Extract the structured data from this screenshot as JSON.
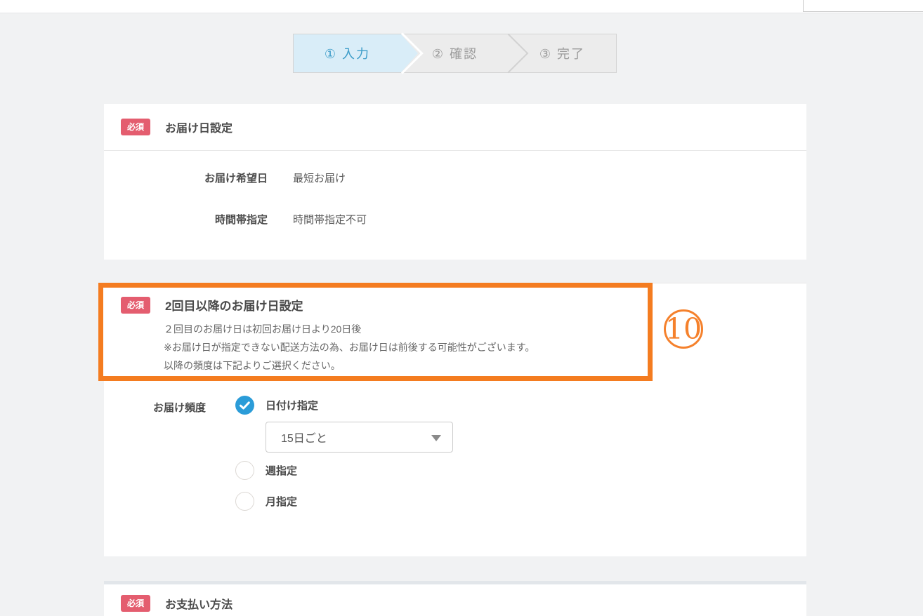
{
  "theme": {
    "background": "#f1f2f3",
    "card_bg": "#ffffff",
    "accent_orange": "#f47c20",
    "badge_red": "#e45d6f",
    "radio_selected_blue": "#2b9cd8",
    "stepper_active_bg": "#d9edf8",
    "stepper_active_text": "#3e9dc9",
    "stepper_inactive_text": "#9b9b9b"
  },
  "stepper": {
    "steps": [
      {
        "label": "① 入力",
        "state": "active"
      },
      {
        "label": "② 確認",
        "state": "upcoming"
      },
      {
        "label": "③ 完了",
        "state": "upcoming"
      }
    ]
  },
  "sections": {
    "delivery": {
      "required_badge": "必須",
      "title": "お届け日設定",
      "rows": [
        {
          "label": "お届け希望日",
          "value": "最短お届け"
        },
        {
          "label": "時間帯指定",
          "value": "時間帯指定不可"
        }
      ]
    },
    "recurring": {
      "required_badge": "必須",
      "title": "2回目以降のお届け日設定",
      "description_lines": [
        "２回目のお届け日は初回お届け日より20日後",
        "※お届け日が指定できない配送方法の為、お届け日は前後する可能性がございます。",
        "以降の頻度は下記よりご選択ください。"
      ],
      "annotation_number": "10",
      "frequency": {
        "label": "お届け頻度",
        "options": [
          {
            "label": "日付け指定",
            "selected": true
          },
          {
            "label": "週指定",
            "selected": false
          },
          {
            "label": "月指定",
            "selected": false
          }
        ],
        "interval_select_value": "15日ごと"
      }
    },
    "payment": {
      "required_badge": "必須",
      "title": "お支払い方法"
    }
  }
}
